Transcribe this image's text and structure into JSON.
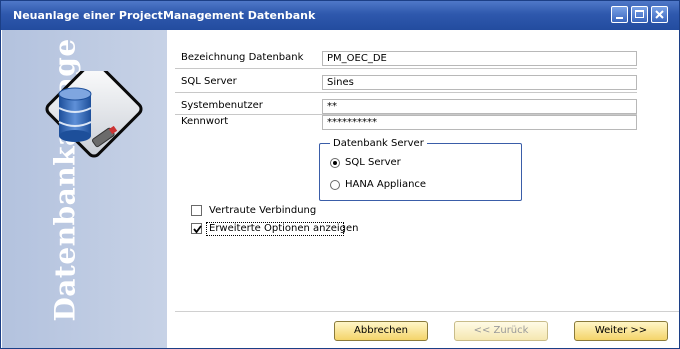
{
  "window": {
    "title": "Neuanlage einer ProjectManagement Datenbank",
    "controls": [
      "minimize-icon",
      "maximize-icon",
      "close-icon"
    ]
  },
  "sidebar": {
    "text": "Datenbankanlage",
    "icon": "database-icon"
  },
  "form": {
    "db_name": {
      "label": "Bezeichnung Datenbank",
      "value": "PM_OEC_DE"
    },
    "sql_server": {
      "label": "SQL Server",
      "value": "Sines"
    },
    "system_user": {
      "label": "Systembenutzer",
      "value": "**"
    },
    "password": {
      "label": "Kennwort",
      "value": "**********"
    }
  },
  "db_server_group": {
    "title": "Datenbank Server",
    "options": [
      {
        "label": "SQL Server",
        "selected": true
      },
      {
        "label": "HANA Appliance",
        "selected": false
      }
    ]
  },
  "checkboxes": [
    {
      "label": "Vertraute Verbindung",
      "checked": false
    },
    {
      "label": "Erweiterte Optionen anzeigen",
      "checked": true
    }
  ],
  "buttons": {
    "cancel": "Abbrechen",
    "back": "<< Zurück",
    "next": "Weiter >>"
  },
  "colors": {
    "titlebar": "#2e58ad",
    "sidebar": "#b3c2de",
    "button": "#f4d46a",
    "group_border": "#3a5da8"
  }
}
